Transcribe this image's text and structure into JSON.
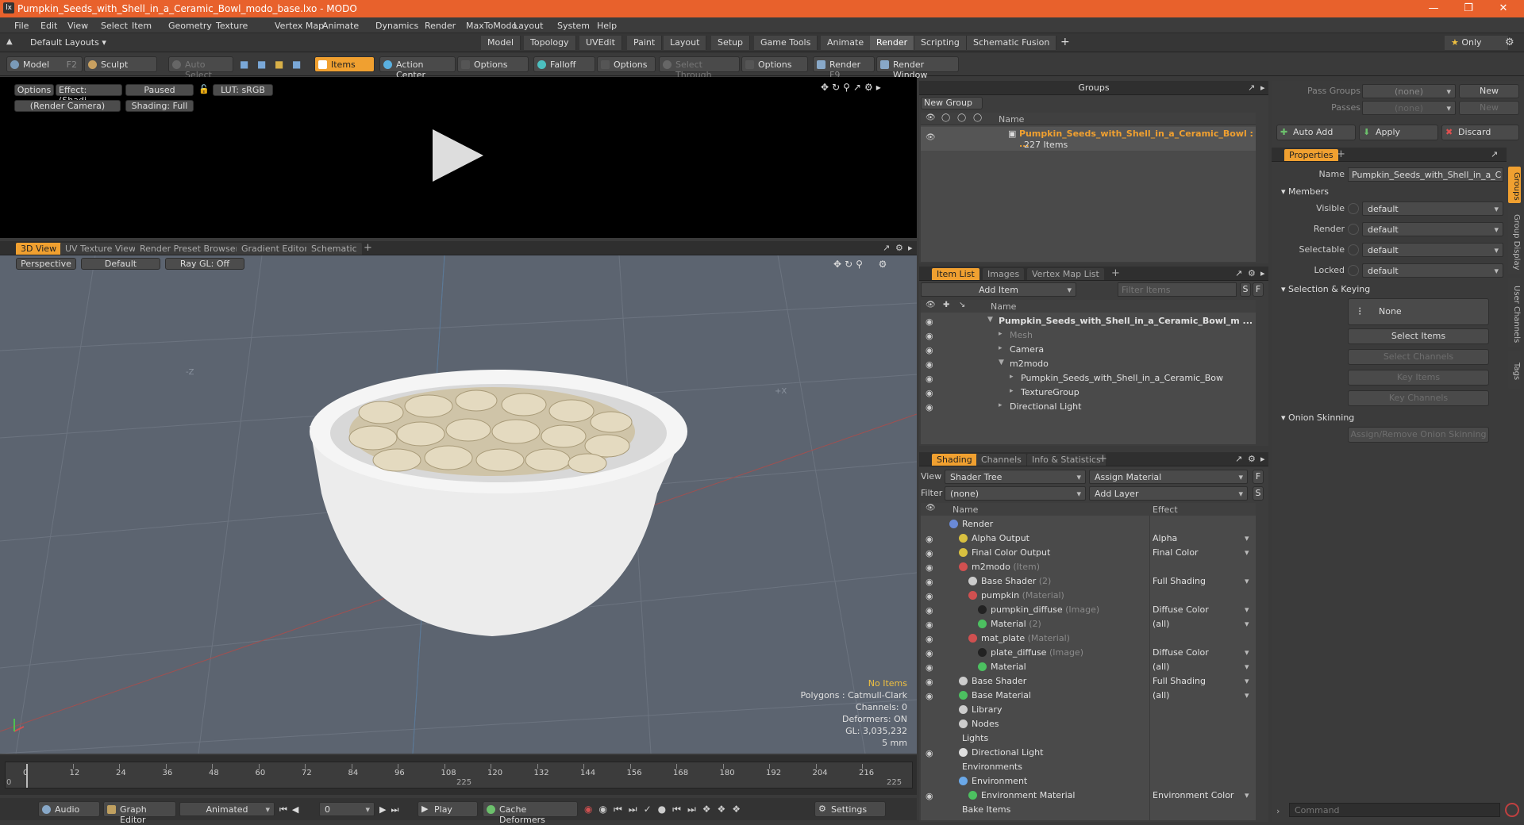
{
  "app": {
    "title": "Pumpkin_Seeds_with_Shell_in_a_Ceramic_Bowl_modo_base.lxo - MODO",
    "logo": "lx"
  },
  "menu": [
    "File",
    "Edit",
    "View",
    "Select",
    "Item",
    "Geometry",
    "Texture",
    "Vertex Map",
    "Animate",
    "Dynamics",
    "Render",
    "MaxToModo",
    "Layout",
    "System",
    "Help"
  ],
  "layouts": {
    "label": "Default Layouts",
    "tabs": [
      "Model",
      "Topology",
      "UVEdit",
      "Paint",
      "Layout",
      "Setup",
      "Game Tools",
      "Animate",
      "Render",
      "Scripting",
      "Schematic Fusion"
    ],
    "active": "Render",
    "only": "Only"
  },
  "toolbar": {
    "model": "Model",
    "model_key": "F2",
    "sculpt": "Sculpt",
    "auto_select": "Auto Select",
    "items": "Items",
    "action_center": "Action Center",
    "options1": "Options",
    "falloff": "Falloff",
    "options2": "Options",
    "select_through": "Select Through",
    "options3": "Options",
    "render": "Render",
    "render_key": "F9",
    "render_window": "Render Window"
  },
  "render_view": {
    "options": "Options",
    "effect": "Effect: (Shadi...",
    "paused": "Paused",
    "lut": "LUT: sRGB",
    "camera": "(Render Camera)",
    "shading": "Shading: Full"
  },
  "viewport": {
    "tabs": [
      "3D View",
      "UV Texture View",
      "Render Preset Browser",
      "Gradient Editor",
      "Schematic"
    ],
    "perspective": "Perspective",
    "default": "Default",
    "raygl": "Ray GL: Off",
    "axis_z": "-Z",
    "axis_x": "+X",
    "info": {
      "no_items": "No Items",
      "polygons": "Polygons : Catmull-Clark",
      "channels": "Channels: 0",
      "deformers": "Deformers: ON",
      "gl": "GL: 3,035,232",
      "unit": "5 mm"
    }
  },
  "timeline": {
    "ticks": [
      "0",
      "12",
      "24",
      "36",
      "48",
      "60",
      "72",
      "84",
      "96",
      "108",
      "120",
      "132",
      "144",
      "156",
      "168",
      "180",
      "192",
      "204",
      "216"
    ],
    "mid": "225",
    "end": "225",
    "start": "0"
  },
  "bottom": {
    "audio": "Audio",
    "graph": "Graph Editor",
    "animated": "Animated",
    "frame": "0",
    "play": "Play",
    "cache": "Cache Deformers",
    "settings": "Settings"
  },
  "groups": {
    "title": "Groups",
    "new_group": "New Group",
    "col_name": "Name",
    "item_name": "Pumpkin_Seeds_with_Shell_in_a_Ceramic_Bowl : ...",
    "item_count": "227 Items"
  },
  "itemlist": {
    "tabs": [
      "Item List",
      "Images",
      "Vertex Map List"
    ],
    "add_item": "Add Item",
    "filter": "Filter Items",
    "col_name": "Name",
    "rows": [
      {
        "label": "Pumpkin_Seeds_with_Shell_in_a_Ceramic_Bowl_m ...",
        "bold": true,
        "indent": 0
      },
      {
        "label": "Mesh",
        "dim": true,
        "indent": 1
      },
      {
        "label": "Camera",
        "indent": 1
      },
      {
        "label": "m2modo",
        "indent": 1
      },
      {
        "label": "Pumpkin_Seeds_with_Shell_in_a_Ceramic_Bow",
        "indent": 2
      },
      {
        "label": "TextureGroup",
        "indent": 2
      },
      {
        "label": "Directional Light",
        "indent": 1
      }
    ]
  },
  "shading": {
    "tabs": [
      "Shading",
      "Channels",
      "Info & Statistics"
    ],
    "view_label": "View",
    "view": "Shader Tree",
    "assign": "Assign Material",
    "filter_label": "Filter",
    "filter": "(none)",
    "add_layer": "Add Layer",
    "col_name": "Name",
    "col_effect": "Effect",
    "rows": [
      {
        "name": "Render",
        "sub": "",
        "effect": "",
        "indent": 0,
        "eye": false
      },
      {
        "name": "Alpha Output",
        "sub": "",
        "effect": "Alpha",
        "indent": 1,
        "eye": true
      },
      {
        "name": "Final Color Output",
        "sub": "",
        "effect": "Final Color",
        "indent": 1,
        "eye": true
      },
      {
        "name": "m2modo",
        "sub": "(Item)",
        "effect": "",
        "indent": 1,
        "eye": true
      },
      {
        "name": "Base Shader",
        "sub": "(2)",
        "effect": "Full Shading",
        "indent": 2,
        "eye": true
      },
      {
        "name": "pumpkin",
        "sub": "(Material)",
        "effect": "",
        "indent": 2,
        "eye": true
      },
      {
        "name": "pumpkin_diffuse",
        "sub": "(Image)",
        "effect": "Diffuse Color",
        "indent": 3,
        "eye": true
      },
      {
        "name": "Material",
        "sub": "(2)",
        "effect": "(all)",
        "indent": 3,
        "eye": true
      },
      {
        "name": "mat_plate",
        "sub": "(Material)",
        "effect": "",
        "indent": 2,
        "eye": true
      },
      {
        "name": "plate_diffuse",
        "sub": "(Image)",
        "effect": "Diffuse Color",
        "indent": 3,
        "eye": true
      },
      {
        "name": "Material",
        "sub": "",
        "effect": "(all)",
        "indent": 3,
        "eye": true
      },
      {
        "name": "Base Shader",
        "sub": "",
        "effect": "Full Shading",
        "indent": 1,
        "eye": true
      },
      {
        "name": "Base Material",
        "sub": "",
        "effect": "(all)",
        "indent": 1,
        "eye": true
      },
      {
        "name": "Library",
        "sub": "",
        "effect": "",
        "indent": 1,
        "eye": false
      },
      {
        "name": "Nodes",
        "sub": "",
        "effect": "",
        "indent": 1,
        "eye": false
      },
      {
        "name": "Lights",
        "sub": "",
        "effect": "",
        "indent": 0,
        "eye": false
      },
      {
        "name": "Directional Light",
        "sub": "",
        "effect": "",
        "indent": 1,
        "eye": true
      },
      {
        "name": "Environments",
        "sub": "",
        "effect": "",
        "indent": 0,
        "eye": false
      },
      {
        "name": "Environment",
        "sub": "",
        "effect": "",
        "indent": 1,
        "eye": false
      },
      {
        "name": "Environment Material",
        "sub": "",
        "effect": "Environment Color",
        "indent": 2,
        "eye": true
      },
      {
        "name": "Bake Items",
        "sub": "",
        "effect": "",
        "indent": 0,
        "eye": false
      }
    ]
  },
  "props": {
    "pass_groups": "Pass Groups",
    "passes": "Passes",
    "none": "(none)",
    "new": "New",
    "auto_add": "Auto Add",
    "apply": "Apply",
    "discard": "Discard",
    "tab": "Properties",
    "name_label": "Name",
    "name_value": "Pumpkin_Seeds_with_Shell_in_a_C",
    "members": "Members",
    "fields": [
      {
        "label": "Visible",
        "value": "default"
      },
      {
        "label": "Render",
        "value": "default"
      },
      {
        "label": "Selectable",
        "value": "default"
      },
      {
        "label": "Locked",
        "value": "default"
      }
    ],
    "sel_keying": "Selection & Keying",
    "none_btn": "None",
    "select_items": "Select Items",
    "select_channels": "Select Channels",
    "key_items": "Key Items",
    "key_channels": "Key Channels",
    "onion": "Onion Skinning",
    "assign_onion": "Assign/Remove Onion Skinning",
    "side_tabs": [
      "Groups",
      "Group Display",
      "User Channels",
      "Tags"
    ],
    "command": "Command"
  }
}
